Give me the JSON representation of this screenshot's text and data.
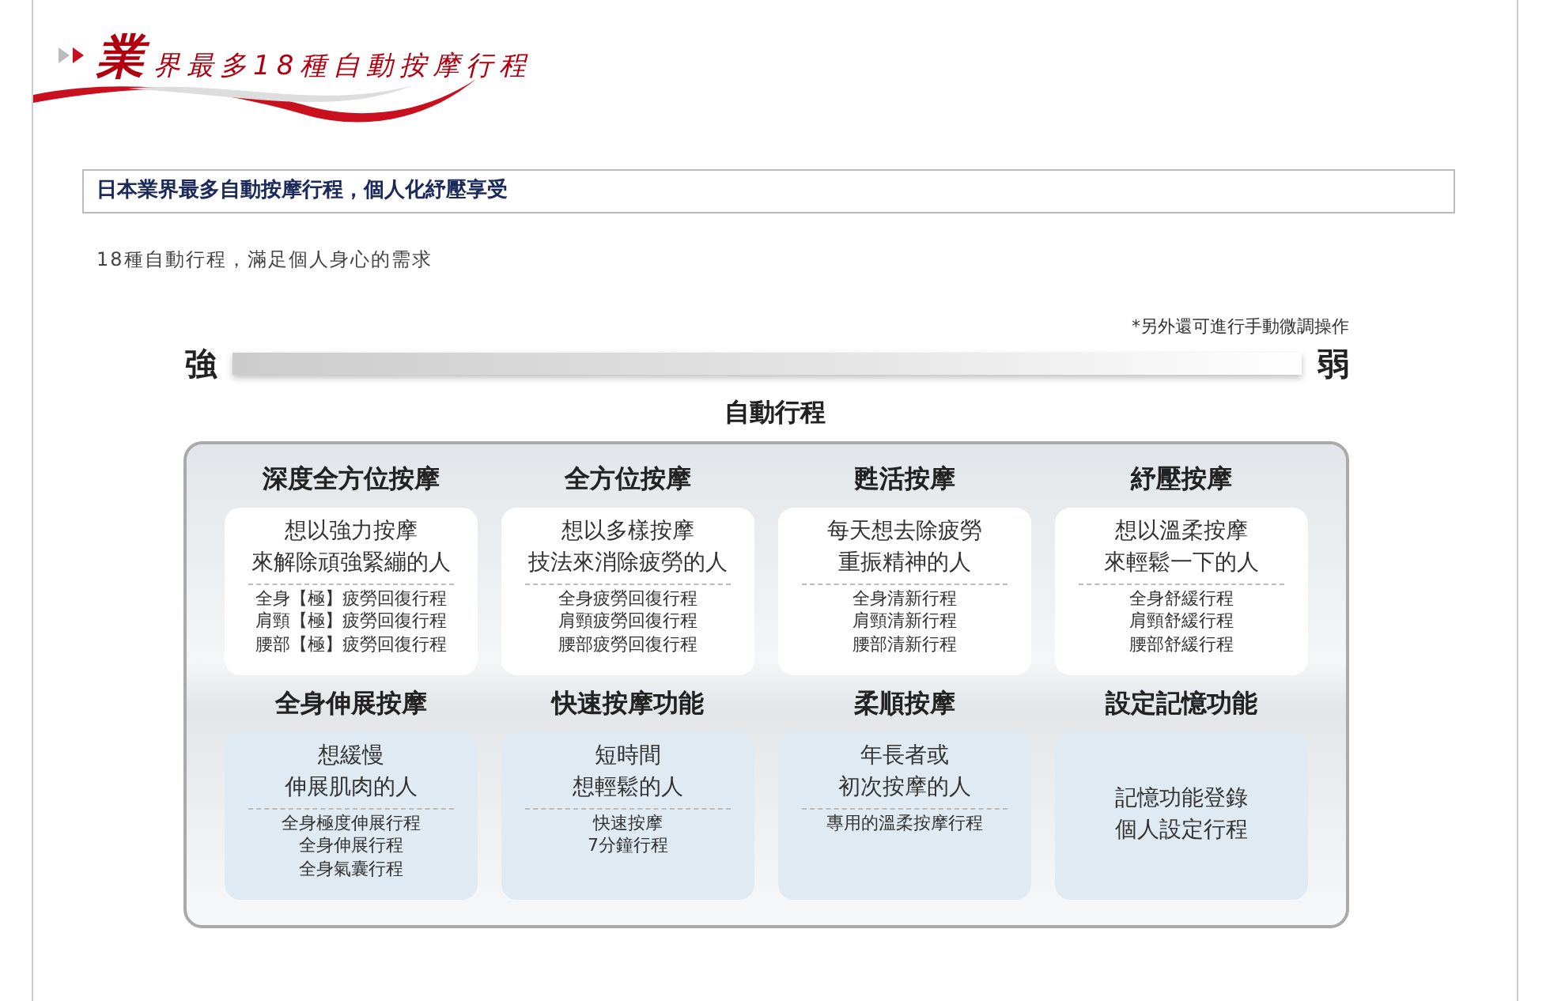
{
  "header": {
    "initial": "業",
    "rest": "界最多18種自動按摩行程"
  },
  "subtitle": "日本業界最多自動按摩行程，個人化紓壓享受",
  "intro": "18種自動行程，滿足個人身心的需求",
  "note": "*另外還可進行手動微調操作",
  "scale": {
    "strong": "強",
    "weak": "弱",
    "caption": "自動行程"
  },
  "courses": [
    {
      "kind": "standard",
      "title": "深度全方位按摩",
      "lines": [
        "想以強力按摩",
        "來解除頑強緊繃的人"
      ],
      "programs": [
        "全身【極】疲勞回復行程",
        "肩頸【極】疲勞回復行程",
        "腰部【極】疲勞回復行程"
      ]
    },
    {
      "kind": "standard",
      "title": "全方位按摩",
      "lines": [
        "想以多樣按摩",
        "技法來消除疲勞的人"
      ],
      "programs": [
        "全身疲勞回復行程",
        "肩頸疲勞回復行程",
        "腰部疲勞回復行程"
      ]
    },
    {
      "kind": "standard",
      "title": "甦活按摩",
      "lines": [
        "每天想去除疲勞",
        "重振精神的人"
      ],
      "programs": [
        "全身清新行程",
        "肩頸清新行程",
        "腰部清新行程"
      ]
    },
    {
      "kind": "standard",
      "title": "紓壓按摩",
      "lines": [
        "想以溫柔按摩",
        "來輕鬆一下的人"
      ],
      "programs": [
        "全身舒緩行程",
        "肩頸舒緩行程",
        "腰部舒緩行程"
      ]
    },
    {
      "kind": "tinted",
      "title": "全身伸展按摩",
      "lines": [
        "想緩慢",
        "伸展肌肉的人"
      ],
      "programs": [
        "全身極度伸展行程",
        "全身伸展行程",
        "全身氣囊行程"
      ]
    },
    {
      "kind": "tinted",
      "title": "快速按摩功能",
      "lines": [
        "短時間",
        "想輕鬆的人"
      ],
      "programs": [
        "快速按摩",
        "7分鐘行程"
      ]
    },
    {
      "kind": "tinted",
      "title": "柔順按摩",
      "lines": [
        "年長者或",
        "初次按摩的人"
      ],
      "programs": [
        "專用的溫柔按摩行程"
      ]
    },
    {
      "kind": "tinted",
      "title": "設定記憶功能",
      "lines": [
        "記憶功能登錄",
        "個人設定行程"
      ]
    }
  ]
}
